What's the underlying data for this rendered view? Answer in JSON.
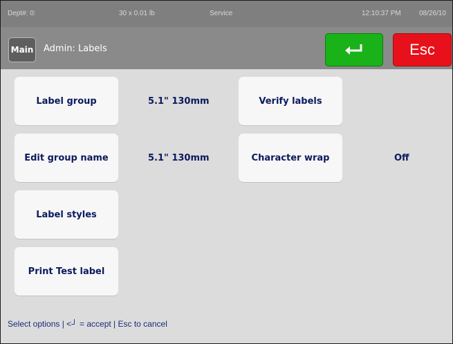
{
  "status": {
    "dept": "Dept#: 0:",
    "scale": "30 x 0.01 lb",
    "mode": "Service",
    "time": "12:10:37 PM",
    "date": "08/26/10"
  },
  "header": {
    "main_label": "Main",
    "title": "Admin: Labels",
    "enter_icon": "return-arrow",
    "esc_label": "Esc",
    "colors": {
      "enter": "#19b219",
      "esc": "#e8101a"
    }
  },
  "options": {
    "label_group": {
      "label": "Label group",
      "value": "5.1\" 130mm"
    },
    "edit_group_name": {
      "label": "Edit group name",
      "value": "5.1\" 130mm"
    },
    "label_styles": {
      "label": "Label styles"
    },
    "print_test_label": {
      "label": "Print Test label"
    },
    "verify_labels": {
      "label": "Verify labels"
    },
    "character_wrap": {
      "label": "Character wrap",
      "value": "Off"
    }
  },
  "footer": {
    "hint": "Select options | <┘ = accept | Esc to cancel"
  }
}
